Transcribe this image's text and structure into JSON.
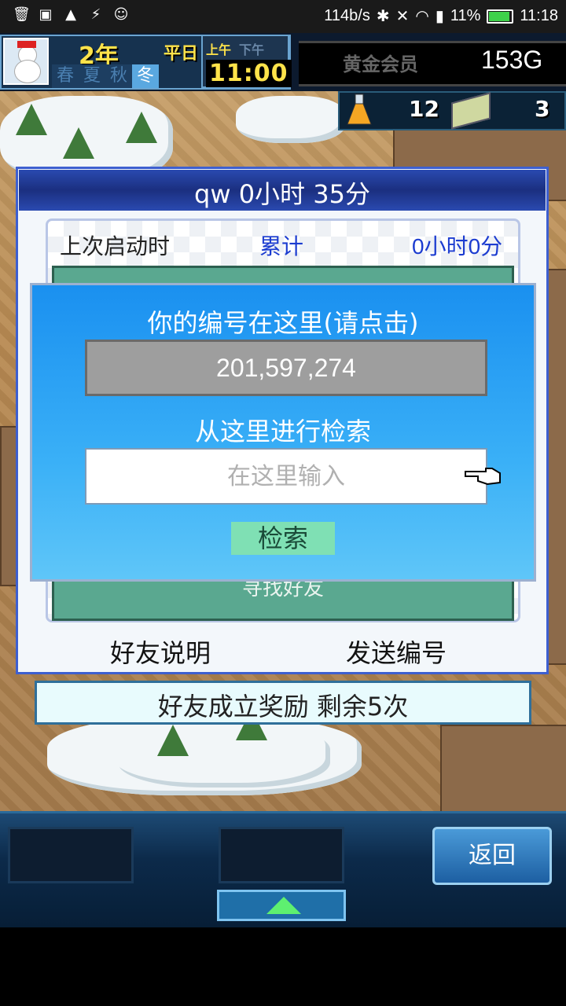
{
  "status_bar": {
    "net_speed": "114b/s",
    "battery": "11%",
    "time": "11:18"
  },
  "hud": {
    "year": "2年",
    "weekday": "平日",
    "seasons": [
      "春",
      "夏",
      "秋",
      "冬"
    ],
    "active_season": "冬",
    "am": "上午",
    "pm": "下午",
    "clock": "11:00",
    "member": "黄金会员",
    "gold": "153G"
  },
  "resources": {
    "research_points": "12",
    "tickets": "3"
  },
  "friend_panel": {
    "title": "qw  0小时 35分",
    "last_launch_label": "上次启动时",
    "total_label": "累计",
    "total_value": "0小时0分",
    "find_friends": "寻找好友",
    "help_label": "好友说明",
    "send_label": "发送编号"
  },
  "search_modal": {
    "title": "你的编号在这里(请点击)",
    "user_id": "201,597,274",
    "search_title": "从这里进行检索",
    "search_placeholder": "在这里输入",
    "search_button": "检索"
  },
  "bonus": {
    "text": "好友成立奖励  剩余5次"
  },
  "bottom": {
    "back_label": "返回"
  }
}
